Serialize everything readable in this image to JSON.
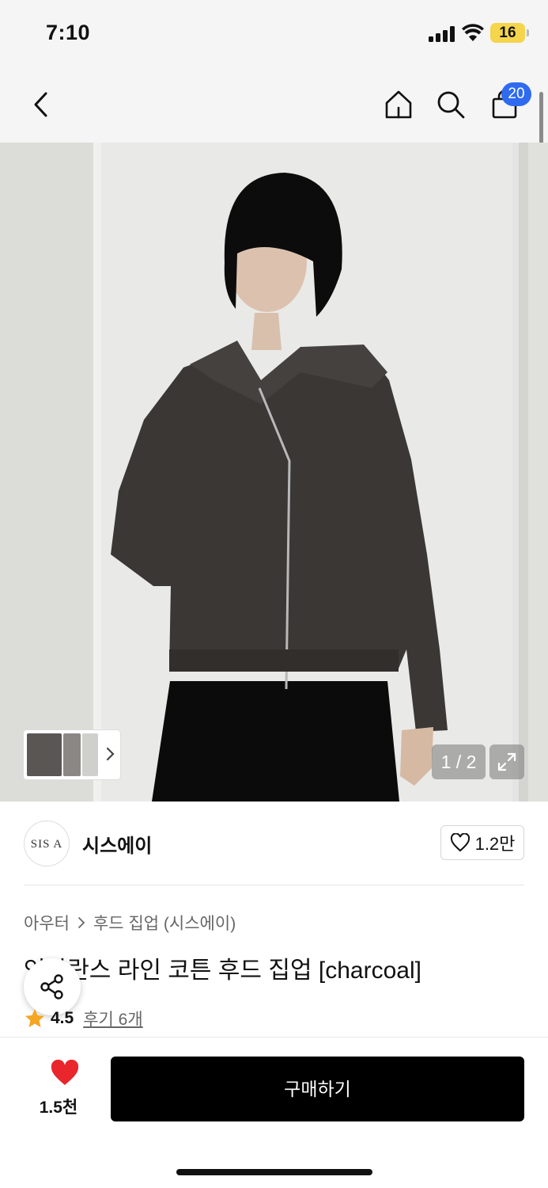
{
  "status_bar": {
    "time": "7:10",
    "battery": "16"
  },
  "nav": {
    "back_icon": "chevron-left-icon",
    "home_icon": "home-icon",
    "search_icon": "search-icon",
    "cart_icon": "shopping-bag-icon",
    "cart_count": "20"
  },
  "gallery": {
    "page_indicator": "1 / 2",
    "expand_icon": "expand-icon"
  },
  "brand": {
    "logo_text": "SIS A",
    "name": "시스에이",
    "like_count": "1.2만"
  },
  "breadcrumb": {
    "category": "아우터",
    "subcategory": "후드 집업 (시스에이)"
  },
  "product": {
    "title": "언발란스 라인 코튼 후드 집업 [charcoal]",
    "rating": "4.5",
    "review_link": "후기 6개"
  },
  "bottom_bar": {
    "wish_count": "1.5천",
    "buy_label": "구매하기"
  },
  "colors": {
    "badge": "#2f6bf0",
    "heart": "#e8262b",
    "star": "#f5a623",
    "buy_button": "#000000"
  }
}
